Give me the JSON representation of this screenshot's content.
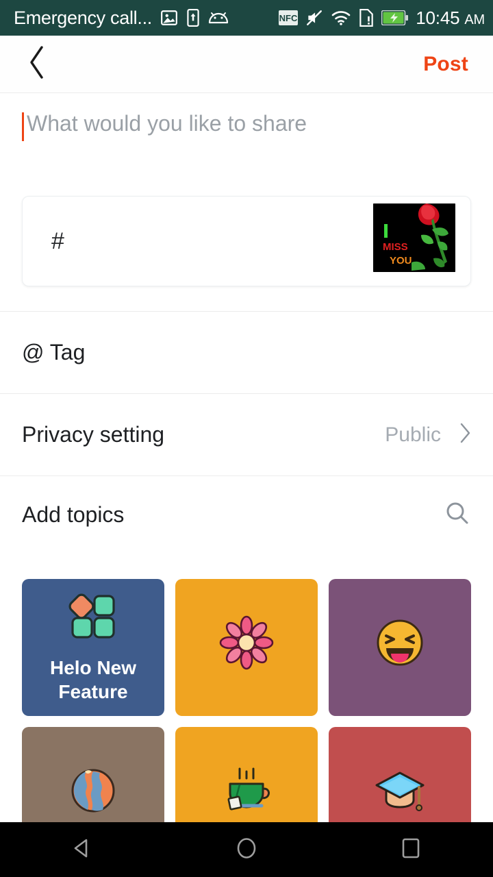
{
  "statusbar": {
    "carrier": "Emergency call...",
    "time": "10:45",
    "ampm": "AM",
    "icons": [
      "image-icon",
      "upload-icon",
      "android-robot-icon",
      "nfc-icon",
      "mute-icon",
      "wifi-icon",
      "sim-alert-icon",
      "battery-charging-icon"
    ],
    "background_color": "#1d4741"
  },
  "appbar": {
    "back_label": "‹",
    "post_label": "Post",
    "post_color": "#ee4415"
  },
  "composer": {
    "placeholder": "What would you like to share",
    "value": "",
    "caret_color": "#ee4415"
  },
  "hashtag_card": {
    "symbol": "#",
    "thumbnail": {
      "name": "i-miss-you-rose-image",
      "line1": "I",
      "line2": "MISS",
      "line3": "YOU",
      "line1_color": "#3cdb3c",
      "line2_color": "#e02020",
      "line3_color": "#f08a1e",
      "background_color": "#000000"
    }
  },
  "rows": [
    {
      "name": "tag-row",
      "label": "@ Tag",
      "value": "",
      "chevron": false
    },
    {
      "name": "privacy-row",
      "label": "Privacy setting",
      "value": "Public",
      "chevron": true
    }
  ],
  "topics": {
    "header": "Add topics",
    "search_icon": "search-icon",
    "tiles": [
      {
        "label": "Helo New Feature",
        "icon": "four-squares-icon",
        "bg": "#3f5c8c"
      },
      {
        "label": "",
        "icon": "flower-icon",
        "bg": "#f0a421"
      },
      {
        "label": "",
        "icon": "laughing-emoji-icon",
        "bg": "#7b5278"
      },
      {
        "label": "",
        "icon": "globe-icon",
        "bg": "#8a7463"
      },
      {
        "label": "",
        "icon": "tea-cup-icon",
        "bg": "#f0a421"
      },
      {
        "label": "",
        "icon": "graduation-cap-icon",
        "bg": "#c14e4e"
      }
    ]
  },
  "navbar": {
    "back": "nav-back-icon",
    "home": "nav-home-icon",
    "recents": "nav-recents-icon"
  }
}
